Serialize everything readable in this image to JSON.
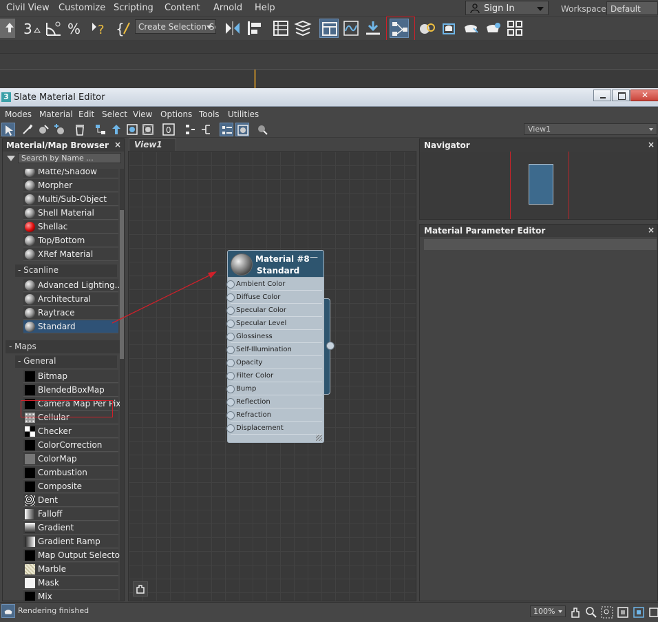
{
  "max": {
    "menus": [
      "Civil View",
      "Customize",
      "Scripting",
      "Content",
      "Arnold",
      "Help"
    ],
    "sign_in": "Sign In",
    "workspaces_label": "Workspaces:",
    "workspace_value": "Default",
    "selection_set_placeholder": "Create Selection Set"
  },
  "editor": {
    "title": "Slate Material Editor",
    "menus": [
      "Modes",
      "Material",
      "Edit",
      "Select",
      "View",
      "Options",
      "Tools",
      "Utilities"
    ],
    "view_select": "View1"
  },
  "browser": {
    "title": "Material/Map Browser",
    "search_placeholder": "Search by Name ...",
    "materials": [
      {
        "label": "Matte/Shadow",
        "icon": "material-sphere-icon"
      },
      {
        "label": "Morpher",
        "icon": "material-sphere-icon"
      },
      {
        "label": "Multi/Sub-Object",
        "icon": "material-sphere-icon"
      },
      {
        "label": "Shell Material",
        "icon": "material-sphere-icon"
      },
      {
        "label": "Shellac",
        "icon": "red-sphere-icon"
      },
      {
        "label": "Top/Bottom",
        "icon": "material-sphere-icon"
      },
      {
        "label": "XRef Material",
        "icon": "material-sphere-icon"
      }
    ],
    "scanline_group": "- Scanline",
    "scanline": [
      {
        "label": "Advanced Lighting..."
      },
      {
        "label": "Architectural"
      },
      {
        "label": "Raytrace"
      },
      {
        "label": "Standard"
      }
    ],
    "maps_group": "- Maps",
    "general_group": "- General",
    "maps": [
      {
        "label": "Bitmap",
        "swatch": "black"
      },
      {
        "label": "BlendedBoxMap",
        "swatch": "black"
      },
      {
        "label": "Camera Map Per Pixel",
        "swatch": "black"
      },
      {
        "label": "Cellular",
        "swatch": "cellular"
      },
      {
        "label": "Checker",
        "swatch": "checker"
      },
      {
        "label": "ColorCorrection",
        "swatch": "black"
      },
      {
        "label": "ColorMap",
        "swatch": "gray"
      },
      {
        "label": "Combustion",
        "swatch": "black"
      },
      {
        "label": "Composite",
        "swatch": "black"
      },
      {
        "label": "Dent",
        "swatch": "dent"
      },
      {
        "label": "Falloff",
        "swatch": "falloff"
      },
      {
        "label": "Gradient",
        "swatch": "gradient"
      },
      {
        "label": "Gradient Ramp",
        "swatch": "ramp"
      },
      {
        "label": "Map Output Selector",
        "swatch": "black"
      },
      {
        "label": "Marble",
        "swatch": "marble"
      },
      {
        "label": "Mask",
        "swatch": "white"
      },
      {
        "label": "Mix",
        "swatch": "black"
      }
    ]
  },
  "view": {
    "tab": "View1",
    "node": {
      "name": "Material #8",
      "type": "Standard",
      "slots": [
        "Ambient Color",
        "Diffuse Color",
        "Specular Color",
        "Specular Level",
        "Glossiness",
        "Self-Illumination",
        "Opacity",
        "Filter Color",
        "Bump",
        "Reflection",
        "Refraction",
        "Displacement"
      ]
    }
  },
  "navigator": {
    "title": "Navigator"
  },
  "param_editor": {
    "title": "Material Parameter Editor"
  },
  "status": {
    "text": "Rendering finished",
    "zoom": "100%"
  },
  "colors": {
    "accent": "#4c6a8a",
    "annotation_red": "#d0202a",
    "node_header": "#2e556f"
  }
}
